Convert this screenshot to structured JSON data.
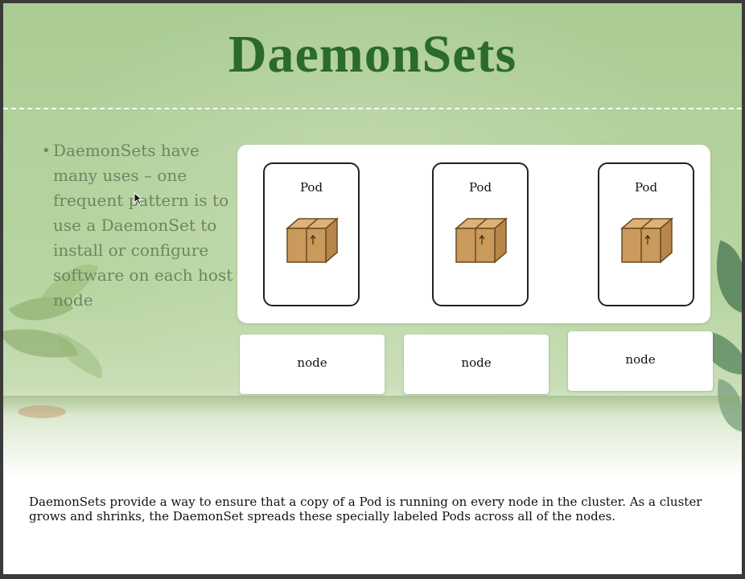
{
  "slide": {
    "title": "DaemonSets",
    "bullet": "DaemonSets have many uses – one frequent pattern is to use a DaemonSet to install or configure software on each host node",
    "pods": [
      {
        "label": "Pod",
        "icon": "box-icon"
      },
      {
        "label": "Pod",
        "icon": "box-icon"
      },
      {
        "label": "Pod",
        "icon": "box-icon"
      }
    ],
    "nodes": [
      {
        "label": "node"
      },
      {
        "label": "node"
      },
      {
        "label": "node"
      }
    ]
  },
  "caption": "DaemonSets provide a way to ensure that a copy of a Pod is running on every node in the cluster. As a cluster grows and shrinks, the DaemonSet spreads these specially labeled Pods across all of the nodes.",
  "colors": {
    "title": "#2a6a2a",
    "background": "#b3d19c",
    "bullet_text": "#6e8560",
    "box": "#c99a5b"
  }
}
